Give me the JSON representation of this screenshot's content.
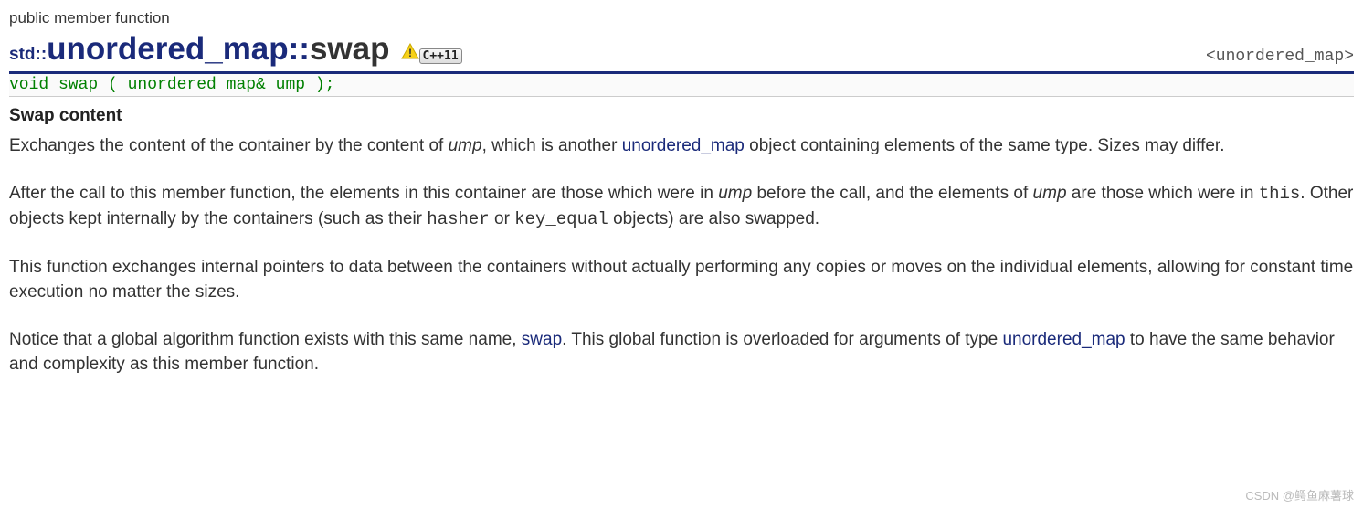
{
  "category": "public member function",
  "title": {
    "namespace": "std::",
    "class_name": "unordered_map",
    "separator": "::",
    "member_name": "swap",
    "badge": "C++11"
  },
  "header_right": "<unordered_map>",
  "signature": "void swap ( unordered_map& ump );",
  "section_heading": "Swap content",
  "para1": {
    "t1": "Exchanges the content of the container by the content of ",
    "i1": "ump",
    "t2": ", which is another ",
    "link1": "unordered_map",
    "t3": " object containing elements of the same type. Sizes may differ."
  },
  "para2": {
    "t1": "After the call to this member function, the elements in this container are those which were in ",
    "i1": "ump",
    "t2": " before the call, and the elements of ",
    "i2": "ump",
    "t3": " are those which were in ",
    "m1": "this",
    "t4": ". Other objects kept internally by the containers (such as their ",
    "m2": "hasher",
    "t5": " or ",
    "m3": "key_equal",
    "t6": " objects) are also swapped."
  },
  "para3": {
    "t1": "This function exchanges internal pointers to data between the containers without actually performing any copies or moves on the individual elements, allowing for constant time execution no matter the sizes."
  },
  "para4": {
    "t1": "Notice that a global algorithm function exists with this same name, ",
    "link1": "swap",
    "t2": ". This global function is overloaded for arguments of type ",
    "link2": "unordered_map",
    "t3": " to have the same behavior and complexity as this member function."
  },
  "watermark": "CSDN @鳄鱼麻薯球"
}
